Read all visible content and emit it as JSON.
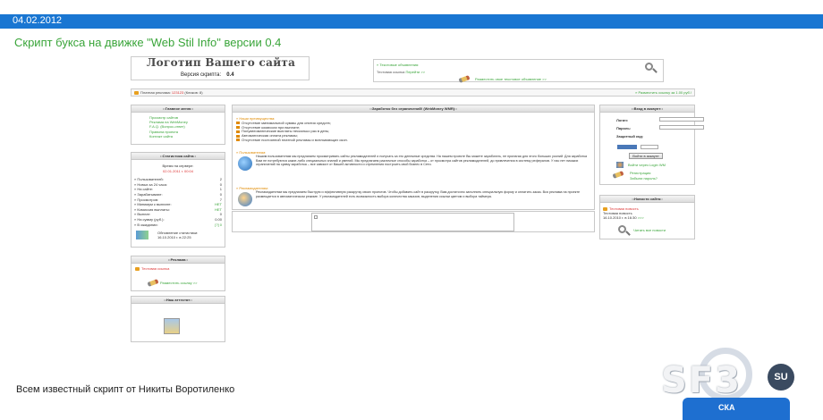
{
  "header": {
    "date": "04.02.2012"
  },
  "post": {
    "title": "Скрипт букса на движке \"Web Stil Info\" версии 0.4",
    "caption": "Всем известный скрипт от Никиты Воротиленко"
  },
  "screenshot": {
    "logo": {
      "title": "Логотип Вашего сайта",
      "version_label": "Версия скрипта:",
      "version": "0.4"
    },
    "text_ads": {
      "title": "» Текстовые объявления:",
      "sample_prefix": "Тестовая ссылка",
      "sample_link": "Перейти >>",
      "place_link": "Разместить свое текстовое объявление >>"
    },
    "paid_bar": {
      "label": "Платная реклама:",
      "amount": "123123",
      "clicks": "(Кликов: 8)",
      "place_link": "» Разместить ссылку за 1.00 руб.!"
    },
    "main_menu": {
      "title": "::Главное меню::",
      "items": [
        "Просмотр сайтов",
        "Реклама на WebMoney",
        "F.A.Q. (Вопрос-ответ)",
        "Правила проекта",
        "Контакт сайта"
      ]
    },
    "stats": {
      "title": "::Статистика сайта::",
      "time_label": "Время на сервере:",
      "time_value": "02.01.2011 г. 00:04",
      "rows": [
        {
          "label": "» Пользователей:",
          "value": "2"
        },
        {
          "label": "» Новых за 24 часа:",
          "value": "0"
        },
        {
          "label": "» На сайте:",
          "value": "1"
        },
        {
          "label": "» Зарабатывают:",
          "value": "0"
        },
        {
          "label": "» Просмотров:",
          "value": "7"
        },
        {
          "label": "» Минимум к выплате:",
          "value": "НЕТ"
        },
        {
          "label": "» Комиссия выплаты:",
          "value": "НЕТ"
        },
        {
          "label": "» Выплат:",
          "value": "0"
        },
        {
          "label": "» На сумму (руб.):",
          "value": "0.00"
        },
        {
          "label": "» В ожидании:",
          "value": "[?] 0"
        }
      ],
      "update_label": "Обновление статистики:",
      "update_value": "16.10.2010 г. в 22:25"
    },
    "ads_box": {
      "title": "::Реклама::",
      "sample": "Тестовая ссылка",
      "place_link": "Разместить ссылку >>"
    },
    "attestat": {
      "title": "::Наш аттестат::"
    },
    "earn": {
      "title": "::Заработок без ограничений! (WebMoney WMR)::",
      "advantages_title": "» Наши преимущества:",
      "advantages": [
        "Отсутствие минимальной суммы для снятия средств;",
        "Отсутствие комиссии при выплате;",
        "Полуавтоматические выплаты несколько раз в день;",
        "Автоматическая оплата рекламы;",
        "Отсутствие постоянной платной рекламы и всплывающих окон."
      ],
      "users_title": "» Пользователям:",
      "users_text": "Нашим пользователям мы предлагаем просматривать сайты рекламодателей и получать за это денежные средства. На нашем проекте Вы можете заработать, не прилагая для этого больших усилий. Для заработка Вам не потребуются какие-либо специальных знаний и умений. Мы предлагаем различные способы заработка – от просмотра сайтов рекламодателей, до привлечения в систему рефералов. У нас нет никаких ограничений на сумму заработка – все зависит от Вашей активности и стремления построить свой бизнес в Сети.",
      "advertisers_title": "» Рекламодателям:",
      "advertisers_text": "Рекламодателям мы предлагаем быструю и эффективную раскрутку своих проектов. Чтобы добавить сайт в раскрутку, Вам достаточно заполнить специальную форму и оплатить заказ. Вся реклама на проекте размещается в автоматическом режиме. У рекламодателей есть возможность выбора количества заказов, выделения ссылки цветом и выбора таймера."
    },
    "login": {
      "title": "::Вход в аккаунт::",
      "login_label": "Логин:",
      "password_label": "Пароль:",
      "code_label": "Защитный код:",
      "submit": "Войти в аккаунт",
      "wm_link": "Войти через Login WM",
      "register": "Регистрация",
      "forgot": "Забыли пароль?"
    },
    "news": {
      "title": "::Новости сайта::",
      "headline": "Тестовая новость",
      "body": "Тестовая новость",
      "date": "16.10.2010 г. в 16:30",
      "more": ">>>",
      "all_link": "Читать все новости"
    }
  },
  "watermark": {
    "logo_text": "SF3",
    "badge": "SU",
    "bar_text": "СКА"
  }
}
